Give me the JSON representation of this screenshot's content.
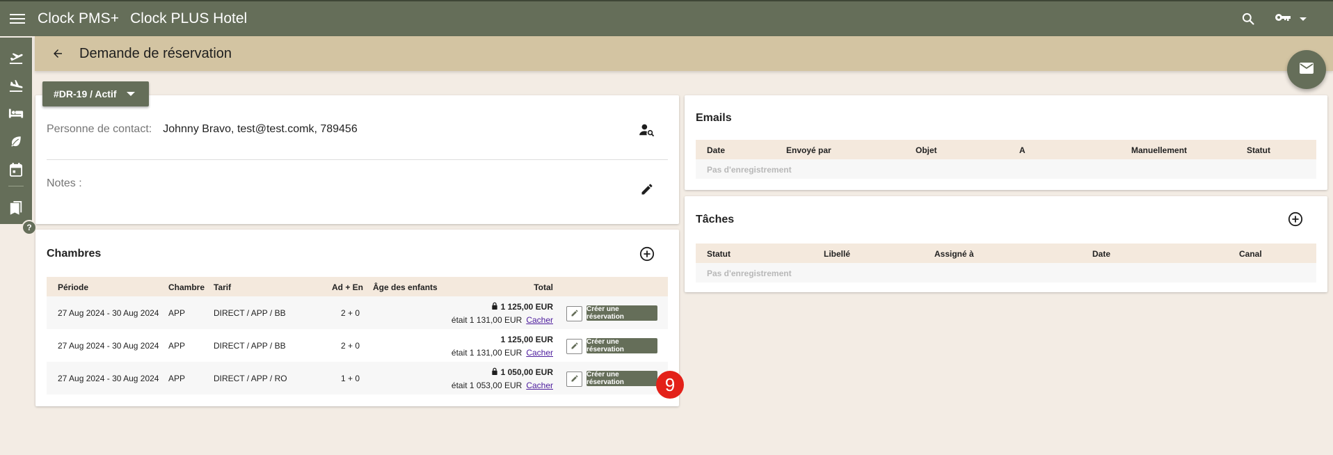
{
  "app": {
    "brand": "Clock PMS+",
    "hotel": "Clock PLUS Hotel"
  },
  "page": {
    "title": "Demande de réservation"
  },
  "status_chip": "#DR-19 / Actif",
  "contact": {
    "label": "Personne de contact:",
    "value": "Johnny Bravo, test@test.comk, 789456"
  },
  "notes": {
    "label": "Notes :"
  },
  "rooms": {
    "title": "Chambres",
    "columns": [
      "Période",
      "Chambre",
      "Tarif",
      "Ad + En",
      "Âge des enfants",
      "Total"
    ],
    "rows": [
      {
        "period": "27 Aug 2024 - 30 Aug 2024",
        "room": "APP",
        "rate": "DIRECT / APP / BB",
        "guests": "2 + 0",
        "total": "1 125,00 EUR",
        "was": "était 1 131,00 EUR",
        "hide": "Cacher",
        "locked": true,
        "create": "Créer une réservation"
      },
      {
        "period": "27 Aug 2024 - 30 Aug 2024",
        "room": "APP",
        "rate": "DIRECT / APP / BB",
        "guests": "2 + 0",
        "total": "1 125,00 EUR",
        "was": "était 1 131,00 EUR",
        "hide": "Cacher",
        "locked": false,
        "create": "Créer une réservation"
      },
      {
        "period": "27 Aug 2024 - 30 Aug 2024",
        "room": "APP",
        "rate": "DIRECT / APP / RO",
        "guests": "1 + 0",
        "total": "1 050,00 EUR",
        "was": "était 1 053,00 EUR",
        "hide": "Cacher",
        "locked": true,
        "create": "Créer une réservation"
      }
    ]
  },
  "badge": "9",
  "emails": {
    "title": "Emails",
    "columns": [
      "Date",
      "Envoyé par",
      "Objet",
      "A",
      "Manuellement",
      "Statut"
    ],
    "empty": "Pas d'enregistrement"
  },
  "tasks": {
    "title": "Tâches",
    "columns": [
      "Statut",
      "Libellé",
      "Assigné à",
      "Date",
      "Canal"
    ],
    "empty": "Pas d'enregistrement"
  },
  "icons": {
    "top": [
      "menu-icon",
      "search-icon",
      "key-icon",
      "caret-down-icon"
    ],
    "sidebar": [
      "flight-takeoff-icon",
      "flight-land-icon",
      "bed-icon",
      "leaf-icon",
      "calendar-icon",
      "bookmarks-icon",
      "help-icon"
    ],
    "fab": "mail-icon"
  },
  "colors": {
    "primary": "#656e59",
    "subheader": "#d3c4a2",
    "background": "#f3ece4",
    "badge": "#e32119",
    "link": "#4b1a9c"
  }
}
